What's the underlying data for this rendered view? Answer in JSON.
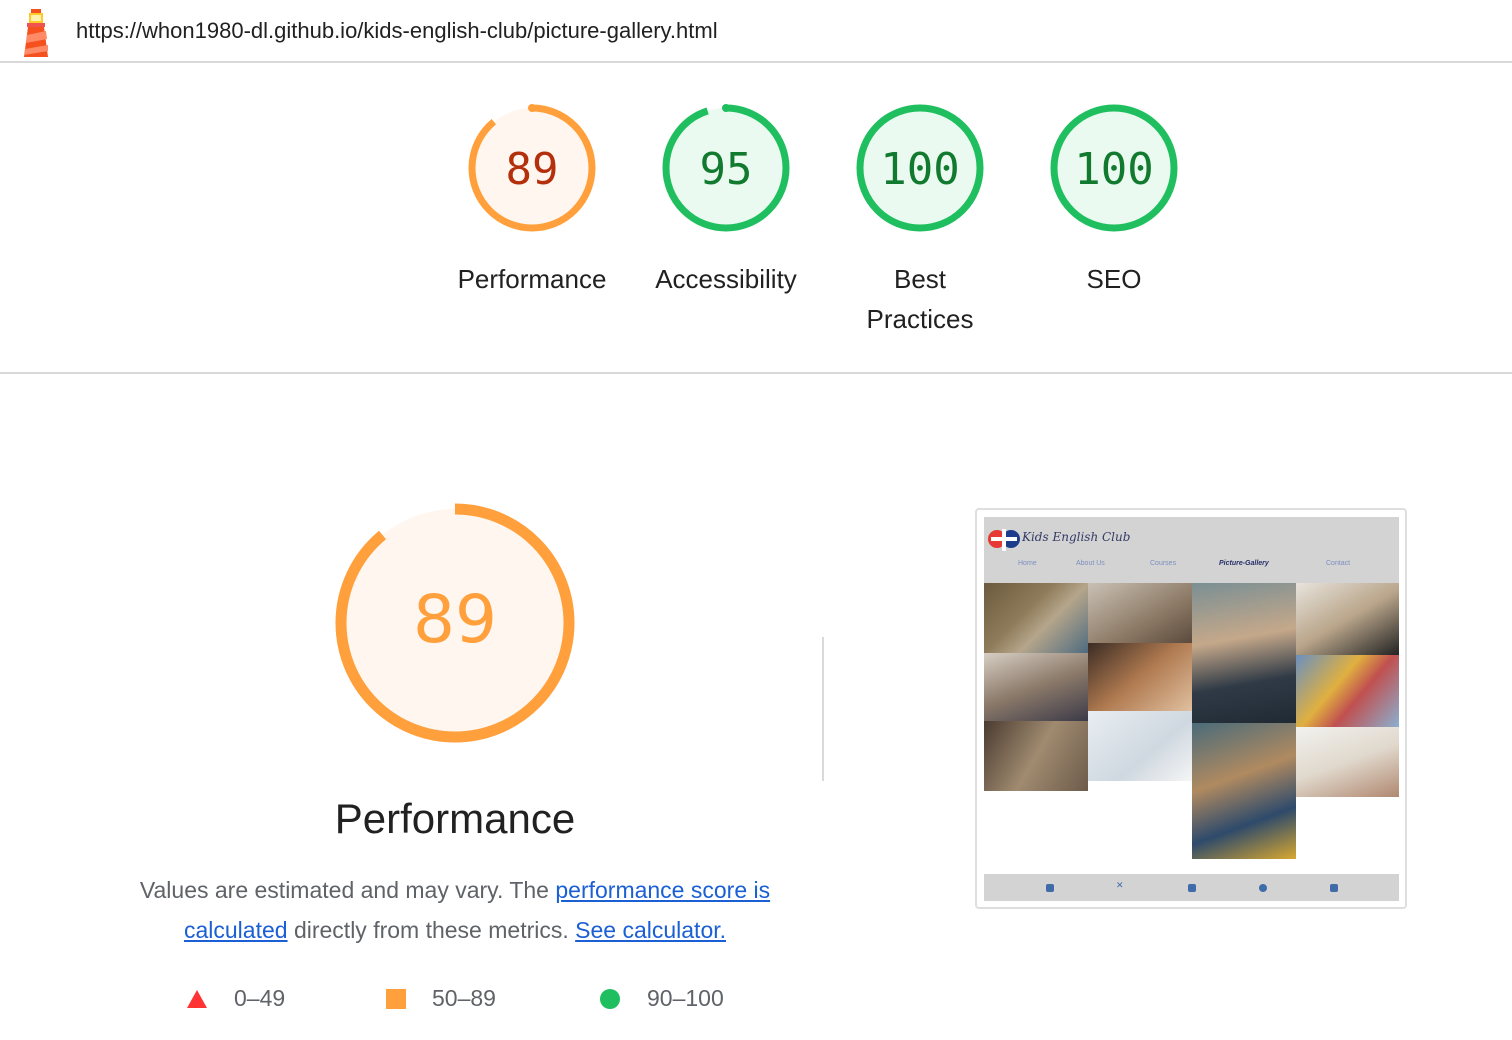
{
  "header": {
    "url": "https://whon1980-dl.github.io/kids-english-club/picture-gallery.html",
    "logo_icon": "lighthouse-icon"
  },
  "scores": [
    {
      "label": "Performance",
      "score": 89,
      "color": "#ffa03c",
      "text_color": "#b42f0c",
      "fill": "#fff6ef"
    },
    {
      "label": "Accessibility",
      "score": 95,
      "color": "#1fbf5f",
      "text_color": "#127a2e",
      "fill": "#eafaf0"
    },
    {
      "label": "Best Practices",
      "score": 100,
      "color": "#1fbf5f",
      "text_color": "#127a2e",
      "fill": "#eafaf0"
    },
    {
      "label": "SEO",
      "score": 100,
      "color": "#1fbf5f",
      "text_color": "#127a2e",
      "fill": "#eafaf0"
    }
  ],
  "performance": {
    "score": 89,
    "title": "Performance",
    "desc_prefix": "Values are estimated and may vary. The ",
    "link1": "performance score is calculated",
    "desc_middle": " directly from these metrics. ",
    "link2": "See calculator."
  },
  "legend": [
    {
      "range": "0–49",
      "shape": "triangle",
      "color": "#f33"
    },
    {
      "range": "50–89",
      "shape": "square",
      "color": "#ffa03c"
    },
    {
      "range": "90–100",
      "shape": "circle",
      "color": "#1fbf5f"
    }
  ],
  "screenshot": {
    "brand": "Kids English Club",
    "nav": [
      "Home",
      "About Us",
      "Courses",
      "Picture-Gallery",
      "Contact"
    ],
    "active_nav": "Picture-Gallery",
    "footer_icons": [
      "facebook-icon",
      "x-icon",
      "youtube-icon",
      "pinterest-icon",
      "linkedin-icon"
    ]
  }
}
